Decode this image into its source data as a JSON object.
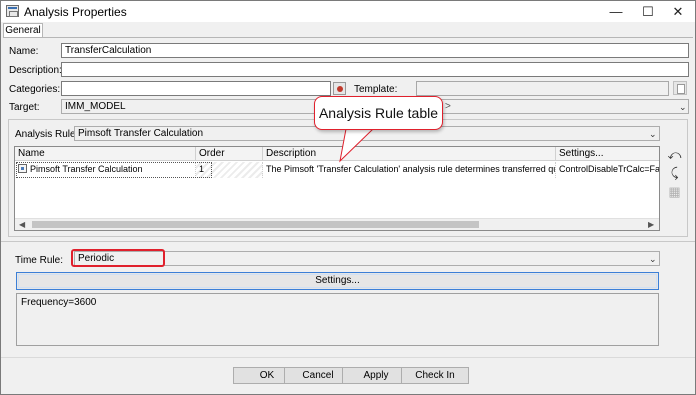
{
  "window": {
    "title": "Analysis Properties",
    "controls": {
      "minimize": "—",
      "maximize": "☐",
      "close": "✕"
    }
  },
  "tabs": [
    {
      "label": "General"
    }
  ],
  "form": {
    "name": {
      "label": "Name:",
      "value": "TransferCalculation"
    },
    "description": {
      "label": "Description:",
      "value": ""
    },
    "categories": {
      "label": "Categories:",
      "value": ""
    },
    "template": {
      "label": "Template:",
      "value": ""
    },
    "target": {
      "label": "Target:",
      "value": "IMM_MODEL",
      "trailing": ">"
    }
  },
  "analysis_rule": {
    "label": "Analysis Rule:",
    "value": "Pimsoft Transfer Calculation",
    "table": {
      "columns": [
        "Name",
        "Order",
        "Description",
        "Settings..."
      ],
      "rows": [
        {
          "name": "Pimsoft Transfer Calculation",
          "order": "1",
          "description": "The Pimsoft 'Transfer Calculation' analysis rule determines transferred quanti...",
          "settings": "ControlDisableTrCalc=False;"
        }
      ]
    }
  },
  "time_rule": {
    "label": "Time Rule:",
    "value": "Periodic",
    "settings_button": "Settings...",
    "settings_text": "Frequency=3600"
  },
  "callout": {
    "text": "Analysis Rule table"
  },
  "buttons": {
    "ok": "OK",
    "cancel": "Cancel",
    "apply": "Apply",
    "checkin": "Check In"
  },
  "colors": {
    "highlight": "#e0202c",
    "focus": "#3c7fd6"
  }
}
